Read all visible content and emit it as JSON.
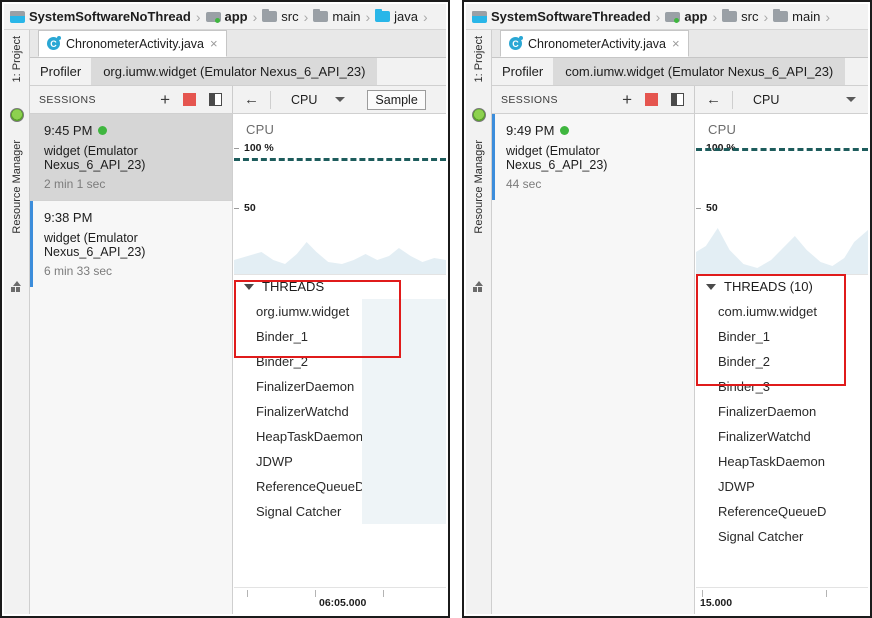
{
  "left_panel": {
    "breadcrumb": {
      "items": [
        {
          "label": "SystemSoftwareNoThread",
          "icon": "module-icon",
          "bold": true
        },
        {
          "label": "app",
          "icon": "app-module-icon",
          "bold": true
        },
        {
          "label": "src",
          "icon": "folder-icon",
          "bold": false
        },
        {
          "label": "main",
          "icon": "folder-icon",
          "bold": false
        },
        {
          "label": "java",
          "icon": "folder-blue-icon",
          "bold": false
        }
      ],
      "separator": "›"
    },
    "rail": {
      "project_label": "1: Project",
      "resource_label": "Resource Manager"
    },
    "tab": {
      "label": "ChronometerActivity.java",
      "icon_letter": "C",
      "close": "×"
    },
    "profiler": {
      "title": "Profiler",
      "process": "org.iumw.widget (Emulator Nexus_6_API_23)"
    },
    "toolbar": {
      "sessions_label": "SESSIONS",
      "add_icon": "+",
      "stop_icon": "stop-icon",
      "layout_icon": "layout-icon",
      "back_icon": "←",
      "cpu_label": "CPU",
      "caret_icon": "chevron-down-icon",
      "sample_label": "Sample"
    },
    "sessions": [
      {
        "time": "9:45 PM",
        "name": "widget (Emulator Nexus_6_API_23)",
        "duration": "2 min 1 sec",
        "running": true,
        "selected": true
      },
      {
        "time": "9:38 PM",
        "name": "widget (Emulator Nexus_6_API_23)",
        "duration": "6 min 33 sec",
        "running": false,
        "selected": false
      }
    ],
    "cpu_chart": {
      "title": "CPU",
      "labels": [
        "100 %",
        "50"
      ]
    },
    "threads": {
      "header": "THREADS",
      "items": [
        "org.iumw.widget",
        "Binder_1",
        "Binder_2",
        "FinalizerDaemon",
        "FinalizerWatchd",
        "HeapTaskDaemon",
        "JDWP",
        "ReferenceQueueD",
        "Signal Catcher"
      ]
    },
    "timeline": {
      "label": "06:05.000"
    }
  },
  "right_panel": {
    "breadcrumb": {
      "items": [
        {
          "label": "SystemSoftwareThreaded",
          "icon": "module-icon",
          "bold": true
        },
        {
          "label": "app",
          "icon": "app-module-icon",
          "bold": true
        },
        {
          "label": "src",
          "icon": "folder-icon",
          "bold": false
        },
        {
          "label": "main",
          "icon": "folder-icon",
          "bold": false
        }
      ],
      "separator": "›"
    },
    "rail": {
      "project_label": "1: Project",
      "resource_label": "Resource Manager"
    },
    "tab": {
      "label": "ChronometerActivity.java",
      "icon_letter": "C",
      "close": "×"
    },
    "profiler": {
      "title": "Profiler",
      "process": "com.iumw.widget (Emulator Nexus_6_API_23)"
    },
    "toolbar": {
      "sessions_label": "SESSIONS",
      "add_icon": "+",
      "stop_icon": "stop-icon",
      "layout_icon": "layout-icon",
      "back_icon": "←",
      "cpu_label": "CPU",
      "caret_icon": "chevron-down-icon",
      "sample_label": ""
    },
    "sessions": [
      {
        "time": "9:49 PM",
        "name": "widget (Emulator Nexus_6_API_23)",
        "duration": "44 sec",
        "running": true,
        "selected": true
      }
    ],
    "cpu_chart": {
      "title": "CPU",
      "labels": [
        "100 %",
        "50"
      ]
    },
    "threads": {
      "header": "THREADS (10)",
      "items": [
        "com.iumw.widget",
        "Binder_1",
        "Binder_2",
        "Binder_3",
        "FinalizerDaemon",
        "FinalizerWatchd",
        "HeapTaskDaemon",
        "JDWP",
        "ReferenceQueueD",
        "Signal Catcher"
      ]
    },
    "timeline": {
      "label": "15.000"
    }
  },
  "highlight_color": "#e01b1b"
}
